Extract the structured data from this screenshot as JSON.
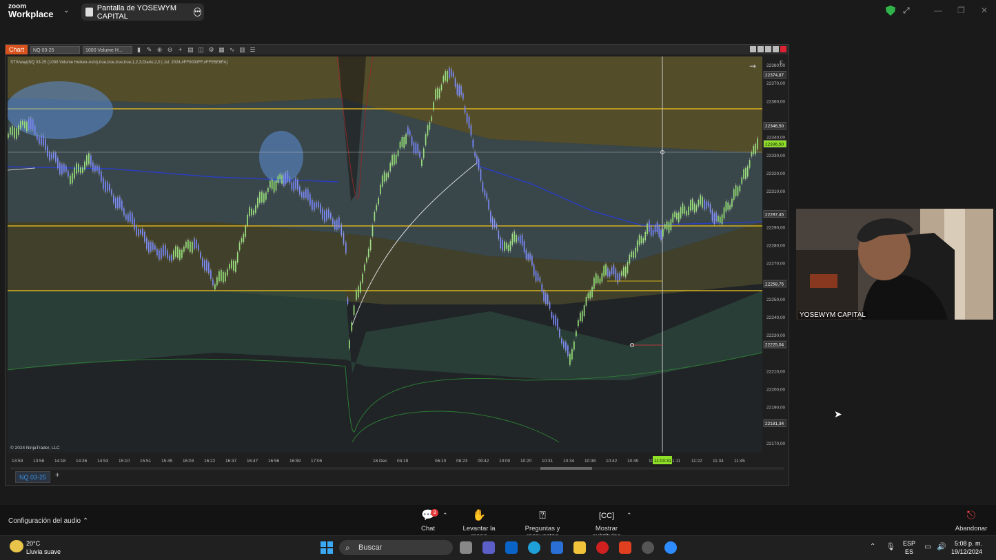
{
  "zoom": {
    "logo_line1": "zoom",
    "logo_line2": "Workplace",
    "share_title": "Pantalla de YOSEWYM CAPITAL",
    "participant_name": "YOSEWYM CAPITAL",
    "audio_config": "Configuración del audio",
    "toolbar": {
      "chat": "Chat",
      "chat_badge": "3",
      "raise_hand": "Levantar la mano",
      "qa": "Preguntas y respuestas",
      "captions": "Mostrar subtítulos",
      "leave": "Abandonar"
    }
  },
  "ninja": {
    "tab": "Chart",
    "instrument_select": "NQ 03-25",
    "period_select": "1000 Volume H...",
    "indicator_label": "STIVwap(NQ 03-25 (1000 Volume Heiken-Ashi),true,true,true,true,1,2,3,Diario,2,0 | Jul. 2024,#FF0000FF,#FFE6E6FA)",
    "copyright": "© 2024 NinjaTrader, LLC",
    "f_label": "F",
    "bottom_tab": "NQ 03-25",
    "price_ticks": [
      "22380,00",
      "22370,00",
      "22360,00",
      "22340,00",
      "22330,00",
      "22320,00",
      "22310,00",
      "22290,00",
      "22280,00",
      "22270,00",
      "22250,00",
      "22240,00",
      "22230,00",
      "22210,00",
      "22200,00",
      "22190,00",
      "22170,00"
    ],
    "price_markers": [
      "22374,87",
      "22346,50",
      "22336,50",
      "22297,45",
      "22258,75",
      "22225,04",
      "22181,34"
    ],
    "time_ticks": [
      "13:59",
      "13:58",
      "14:18",
      "14:36",
      "14:53",
      "15:10",
      "15:51",
      "15:45",
      "16:03",
      "16:22",
      "16:37",
      "16:47",
      "16:56",
      "16:59",
      "17:05",
      "16 Dec",
      "04:19",
      "06:10",
      "08:23",
      "09:42",
      "10:00",
      "10:20",
      "10:31",
      "10:34",
      "10:38",
      "10:42",
      "10:49",
      "10:55",
      "11:11",
      "11:22",
      "11:34",
      "11:45"
    ],
    "crosshair_time": "11:03:31",
    "colors": {
      "hline": "#d8b21f",
      "bull": "#7ed65a",
      "bear": "#5b6df0",
      "vwap": "#2b3fc0",
      "marker_green": "#8fe026"
    }
  },
  "taskbar": {
    "temperature": "20°C",
    "weather_desc": "Lluvia suave",
    "search_placeholder": "Buscar",
    "lang_1": "ESP",
    "lang_2": "ES",
    "time": "5:08 p. m.",
    "date": "19/12/2024"
  }
}
